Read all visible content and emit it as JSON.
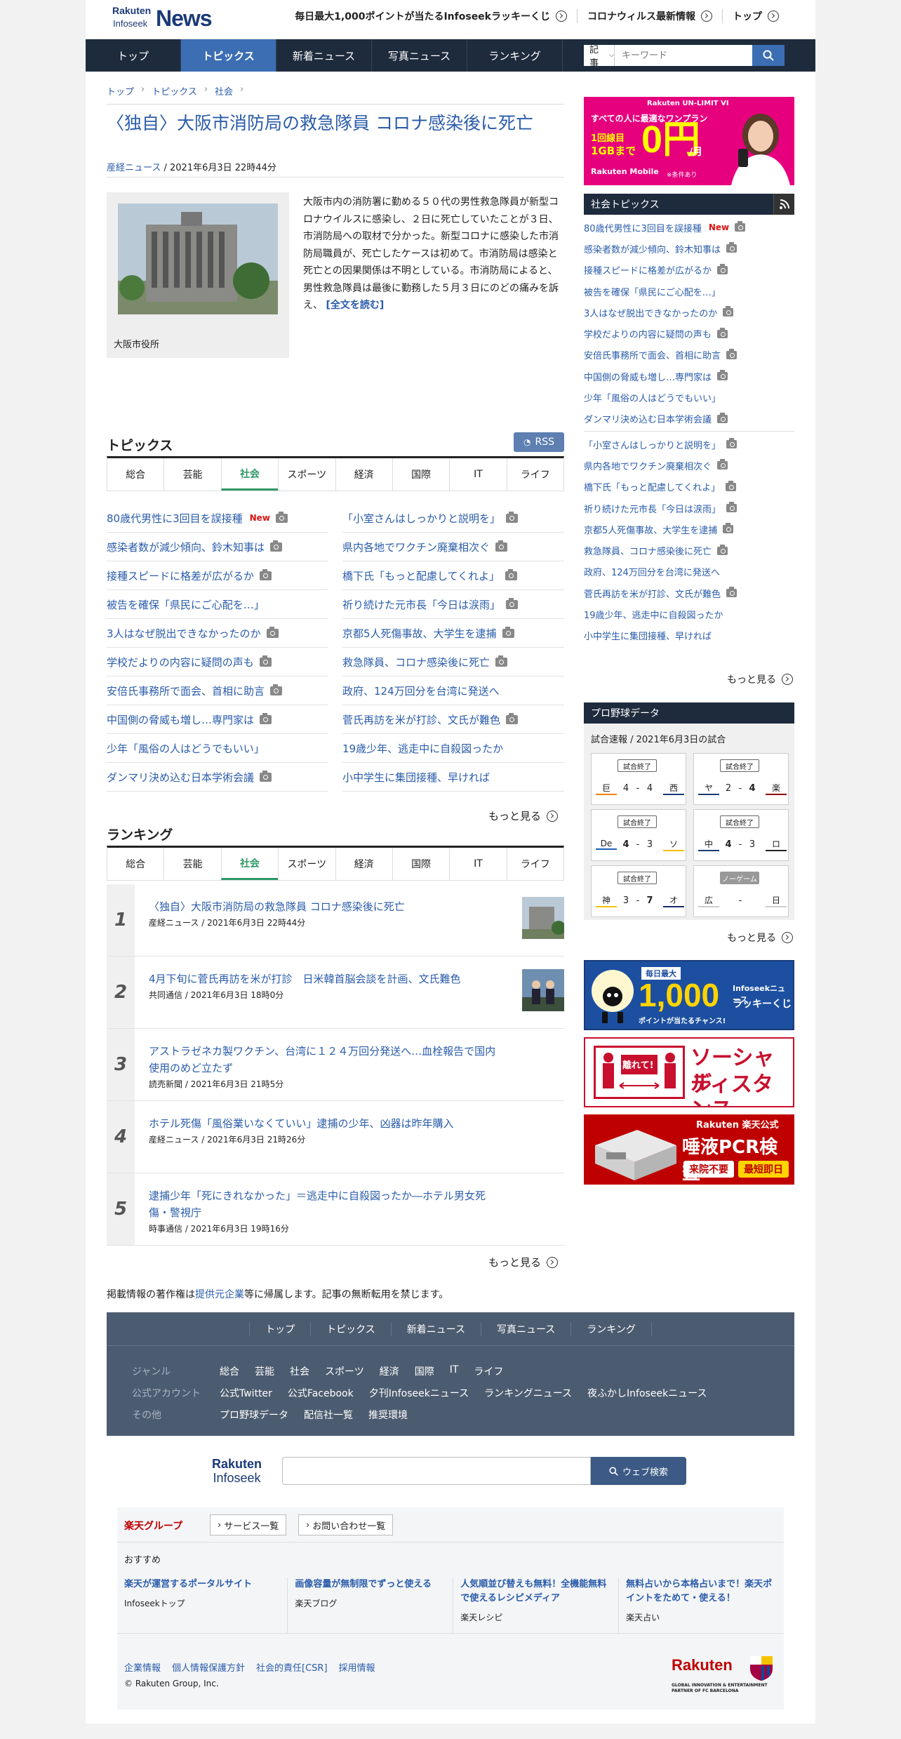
{
  "header": {
    "logo_top": "Rakuten",
    "logo_sub": "Infoseek",
    "logo_main": "News",
    "links": [
      "毎日最大1,000ポイントが当たるInfoseekラッキーくじ",
      "コロナウィルス最新情報",
      "トップ"
    ]
  },
  "nav": {
    "items": [
      "トップ",
      "トピックス",
      "新着ニュース",
      "写真ニュース",
      "ランキング"
    ],
    "active": 1,
    "search_select": "記事",
    "search_placeholder": "キーワード"
  },
  "breadcrumb": [
    "トップ",
    "トピックス",
    "社会"
  ],
  "article": {
    "title": "〈独自〉大阪市消防局の救急隊員 コロナ感染後に死亡",
    "source": "産経ニュース",
    "date": " / 2021年6月3日 22時44分",
    "caption": "大阪市役所",
    "body": "大阪市内の消防署に勤める５０代の男性救急隊員が新型コロナウイルスに感染し、２日に死亡していたことが３日、市消防局への取材で分かった。新型コロナに感染した市消防局職員が、死亡したケースは初めて。市消防局は感染と死亡との因果関係は不明としている。市消防局によると、男性救急隊員は最後に勤務した５月３日にのどの痛みを訴え、",
    "more": "[全文を読む]"
  },
  "topics": {
    "heading": "トピックス",
    "rss": "RSS",
    "tabs": [
      "総合",
      "芸能",
      "社会",
      "スポーツ",
      "経済",
      "国際",
      "IT",
      "ライフ"
    ],
    "active": 2,
    "left": [
      {
        "t": "80歳代男性に3回目を誤接種",
        "new": "New",
        "cam": true
      },
      {
        "t": "感染者数が減少傾向、鈴木知事は",
        "cam": true
      },
      {
        "t": "接種スピードに格差が広がるか",
        "cam": true
      },
      {
        "t": "被告を確保「県民にご心配を…」",
        "cam": false
      },
      {
        "t": "3人はなぜ脱出できなかったのか",
        "cam": true
      },
      {
        "t": "学校だよりの内容に疑問の声も",
        "cam": true
      },
      {
        "t": "安倍氏事務所で面会、首相に助言",
        "cam": true
      },
      {
        "t": "中国側の脅威も増し…専門家は",
        "cam": true
      },
      {
        "t": "少年「風俗の人はどうでもいい」",
        "cam": false
      },
      {
        "t": "ダンマリ決め込む日本学術会議",
        "cam": true
      }
    ],
    "right": [
      {
        "t": "「小室さんはしっかりと説明を」",
        "cam": true
      },
      {
        "t": "県内各地でワクチン廃棄相次ぐ",
        "cam": true
      },
      {
        "t": "橋下氏「もっと配慮してくれよ」",
        "cam": true
      },
      {
        "t": "祈り続けた元市長「今日は涙雨」",
        "cam": true
      },
      {
        "t": "京都5人死傷事故、大学生を逮捕",
        "cam": true
      },
      {
        "t": "救急隊員、コロナ感染後に死亡",
        "cam": true
      },
      {
        "t": "政府、124万回分を台湾に発送へ",
        "cam": false
      },
      {
        "t": "菅氏再訪を米が打診、文氏が難色",
        "cam": true
      },
      {
        "t": "19歳少年、逃走中に自殺図ったか",
        "cam": false
      },
      {
        "t": "小中学生に集団接種、早ければ",
        "cam": false
      }
    ],
    "more": "もっと見る"
  },
  "ranking": {
    "heading": "ランキング",
    "tabs": [
      "総合",
      "芸能",
      "社会",
      "スポーツ",
      "経済",
      "国際",
      "IT",
      "ライフ"
    ],
    "active": 2,
    "more": "もっと見る",
    "items": [
      {
        "n": "1",
        "t": "〈独自〉大阪市消防局の救急隊員 コロナ感染後に死亡",
        "m": "産経ニュース / 2021年6月3日 22時44分",
        "thumb": "building"
      },
      {
        "n": "2",
        "t": "4月下旬に菅氏再訪を米が打診　日米韓首脳会談を計画、文氏難色",
        "m": "共同通信 / 2021年6月3日 18時0分",
        "thumb": "people"
      },
      {
        "n": "3",
        "t": "アストラゼネカ製ワクチン、台湾に１２４万回分発送へ…血栓報告で国内使用のめど立たず",
        "m": "読売新聞 / 2021年6月3日 21時5分",
        "thumb": ""
      },
      {
        "n": "4",
        "t": "ホテル死傷「風俗業いなくていい」逮捕の少年、凶器は昨年購入",
        "m": "産経ニュース / 2021年6月3日 21時26分",
        "thumb": ""
      },
      {
        "n": "5",
        "t": "逮捕少年「死にきれなかった」＝逃走中に自殺図ったか―ホテル男女死傷・警視庁",
        "m": "時事通信 / 2021年6月3日 19時16分",
        "thumb": ""
      }
    ]
  },
  "copyright": {
    "pre": "掲載情報の著作権は",
    "link": "提供元企業",
    "post": "等に帰属します。記事の無断転用を禁じます。"
  },
  "footer": {
    "nav": [
      "トップ",
      "トピックス",
      "新着ニュース",
      "写真ニュース",
      "ランキング"
    ],
    "rows": [
      {
        "label": "ジャンル",
        "items": [
          "総合",
          "芸能",
          "社会",
          "スポーツ",
          "経済",
          "国際",
          "IT",
          "ライフ"
        ]
      },
      {
        "label": "公式アカウント",
        "items": [
          "公式Twitter",
          "公式Facebook",
          "夕刊Infoseekニュース",
          "ランキングニュース",
          "夜ふかしInfoseekニュース"
        ]
      },
      {
        "label": "その他",
        "items": [
          "プロ野球データ",
          "配信社一覧",
          "推奨環境"
        ]
      }
    ]
  },
  "isearch": {
    "logo1": "Rakuten",
    "logo2": "Infoseek",
    "button": "ウェブ検索"
  },
  "rgroup": {
    "name": "楽天グループ",
    "services": "サービス一覧",
    "contact": "お問い合わせ一覧",
    "osusume": "おすすめ",
    "cols": [
      {
        "t": "楽天が運営するポータルサイト",
        "s": "Infoseekトップ"
      },
      {
        "t": "画像容量が無制限でずっと使える",
        "s": "楽天ブログ"
      },
      {
        "t": "人気順並び替えも無料！全機能無料で使えるレシピメディア",
        "s": "楽天レシピ"
      },
      {
        "t": "無料占いから本格占いまで！楽天ポイントをためて・使える！",
        "s": "楽天占い"
      }
    ],
    "bottom": [
      "企業情報",
      "個人情報保護方針",
      "社会的責任[CSR]",
      "採用情報"
    ],
    "copy": "© Rakuten Group, Inc.",
    "logo": "Rakuten",
    "partner": "GLOBAL INNOVATION & ENTERTAINMENT PARTNER OF FC BARCELONA"
  },
  "ad1": {
    "brand": "Rakuten UN-LIMIT VI",
    "l1": "すべての人に最適なワンプラン",
    "l2": "1回線目",
    "l3": "1GBまで",
    "big": "0円",
    "unit": "/月",
    "note": "※条件あり",
    "mobile": "Rakuten Mobile"
  },
  "side_topics": {
    "heading": "社会トピックス",
    "more": "もっと見る",
    "a": [
      {
        "t": "80歳代男性に3回目を誤接種",
        "new": "New",
        "cam": true
      },
      {
        "t": "感染者数が減少傾向、鈴木知事は",
        "cam": true
      },
      {
        "t": "接種スピードに格差が広がるか",
        "cam": true
      },
      {
        "t": "被告を確保「県民にご心配を…」",
        "cam": false
      },
      {
        "t": "3人はなぜ脱出できなかったのか",
        "cam": true
      },
      {
        "t": "学校だよりの内容に疑問の声も",
        "cam": true
      },
      {
        "t": "安倍氏事務所で面会、首相に助言",
        "cam": true
      },
      {
        "t": "中国側の脅威も増し…専門家は",
        "cam": true
      },
      {
        "t": "少年「風俗の人はどうでもいい」",
        "cam": false
      },
      {
        "t": "ダンマリ決め込む日本学術会議",
        "cam": true
      }
    ],
    "b": [
      {
        "t": "「小室さんはしっかりと説明を」",
        "cam": true
      },
      {
        "t": "県内各地でワクチン廃棄相次ぐ",
        "cam": true
      },
      {
        "t": "橋下氏「もっと配慮してくれよ」",
        "cam": true
      },
      {
        "t": "祈り続けた元市長「今日は涙雨」",
        "cam": true
      },
      {
        "t": "京都5人死傷事故、大学生を逮捕",
        "cam": true
      },
      {
        "t": "救急隊員、コロナ感染後に死亡",
        "cam": true
      },
      {
        "t": "政府、124万回分を台湾に発送へ",
        "cam": false
      },
      {
        "t": "菅氏再訪を米が打診、文氏が難色",
        "cam": true
      },
      {
        "t": "19歳少年、逃走中に自殺図ったか",
        "cam": false
      },
      {
        "t": "小中学生に集団接種、早ければ",
        "cam": false
      }
    ]
  },
  "baseball": {
    "heading": "プロ野球データ",
    "sub": "試合速報 / 2021年6月3日の試合",
    "more": "もっと見る",
    "games": [
      {
        "st": "試合終了",
        "h": "巨",
        "hs": "4",
        "as": "4",
        "a": "西",
        "hc": "#f08300",
        "ac": "#1b3a78",
        "hb": false,
        "ab": false
      },
      {
        "st": "試合終了",
        "h": "ヤ",
        "hs": "2",
        "as": "4",
        "a": "楽",
        "hc": "#1b3a78",
        "ac": "#8b0000",
        "hb": false,
        "ab": true
      },
      {
        "st": "試合終了",
        "h": "De",
        "hs": "4",
        "as": "3",
        "a": "ソ",
        "hc": "#1b5fb4",
        "ac": "#f5c000",
        "hb": true,
        "ab": false
      },
      {
        "st": "試合終了",
        "h": "中",
        "hs": "4",
        "as": "3",
        "a": "ロ",
        "hc": "#1b3a78",
        "ac": "#222",
        "hb": true,
        "ab": false
      },
      {
        "st": "試合終了",
        "h": "神",
        "hs": "3",
        "as": "7",
        "a": "オ",
        "hc": "#f5c000",
        "ac": "#1b2a6b",
        "hb": false,
        "ab": true
      },
      {
        "st": "ノーゲーム",
        "h": "広",
        "hs": "",
        "as": "",
        "a": "日",
        "hc": "#ccc",
        "ac": "#ccc",
        "hb": false,
        "ab": false
      }
    ]
  },
  "ad2": {
    "l1": "毎日最大",
    "num": "1,000",
    "l2": "ポイントが当たるチャンス!",
    "r1": "Infoseekニュース",
    "r2": "ラッキーくじ"
  },
  "ad3": {
    "sign": "離れて!",
    "t1": "ソーシャル",
    "t2": "ディスタンス"
  },
  "ad4": {
    "brand": "Rakuten 楽天公式",
    "title": "唾液PCR検査",
    "b1": "来院不要",
    "b2": "最短即日"
  }
}
